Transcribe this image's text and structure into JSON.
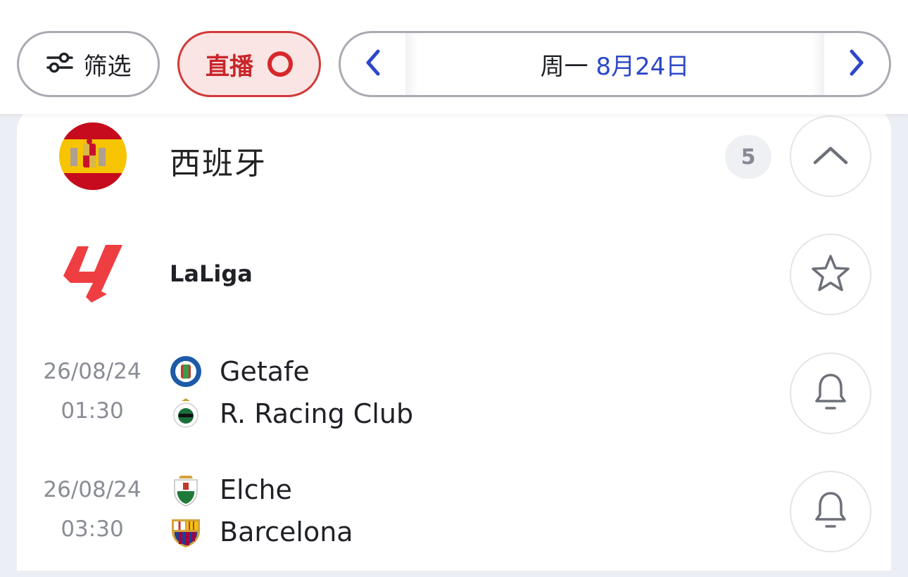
{
  "header": {
    "filter_label": "筛选",
    "live_label": "直播",
    "date": {
      "weekday": "周一",
      "date": "8月24日"
    }
  },
  "section": {
    "country": "西班牙",
    "match_count": "5",
    "league": "LaLiga"
  },
  "matches": [
    {
      "date": "26/08/24",
      "time": "01:30",
      "home": "Getafe",
      "away": "R. Racing Club"
    },
    {
      "date": "26/08/24",
      "time": "03:30",
      "home": "Elche",
      "away": "Barcelona"
    }
  ],
  "colors": {
    "accent_blue": "#2d47c8",
    "live_red": "#d6272b",
    "live_bg": "#fbe4e4",
    "laliga_red": "#ef3e42"
  },
  "icons": [
    "filter-icon",
    "live-ring-icon",
    "chevron-left-icon",
    "chevron-right-icon",
    "chevron-up-icon",
    "star-icon",
    "bell-icon"
  ]
}
